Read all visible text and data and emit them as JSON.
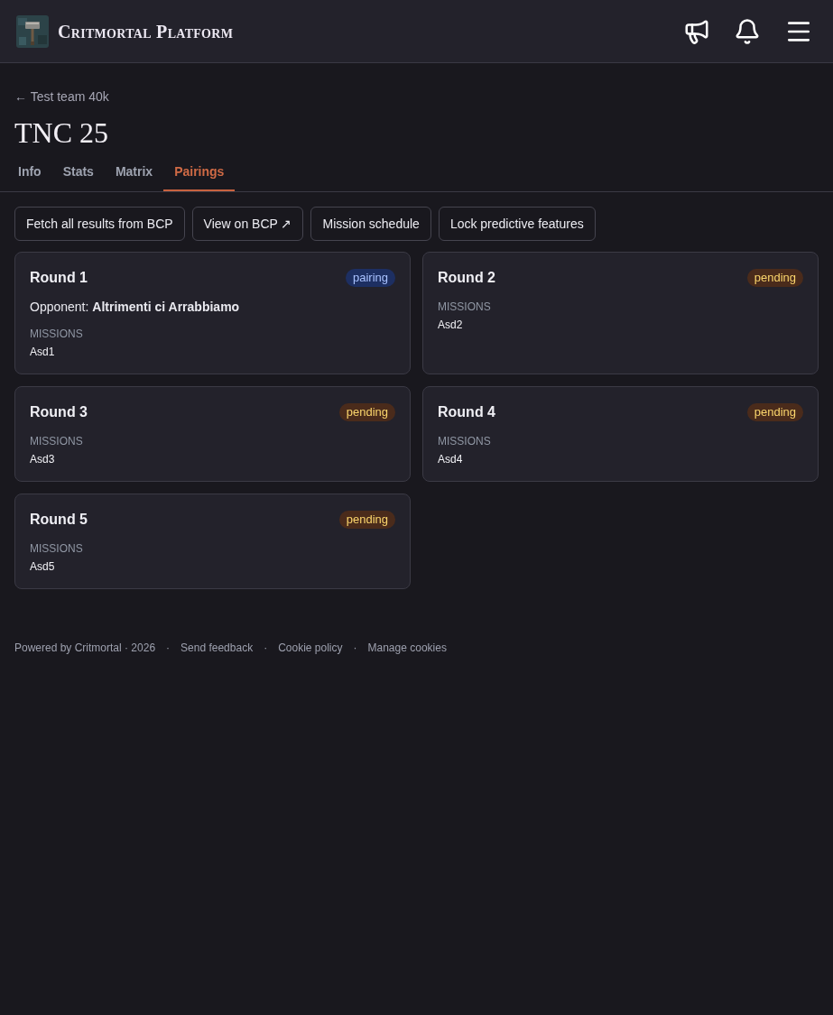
{
  "header": {
    "title": "Critmortal Platform"
  },
  "back_link": "← Test team 40k",
  "page_title": "TNC 25",
  "tabs": [
    {
      "label": "Info",
      "selected": false
    },
    {
      "label": "Stats",
      "selected": false
    },
    {
      "label": "Matrix",
      "selected": false
    },
    {
      "label": "Pairings",
      "selected": true
    }
  ],
  "actions": [
    "Fetch all results from BCP",
    "View on BCP ↗",
    "Mission schedule",
    "Lock predictive features"
  ],
  "rounds": [
    {
      "title": "Round 1",
      "status": {
        "label": "pairing",
        "kind": "pairing"
      },
      "opponent": "Opponent: **Altrimenti ci Arrabbiamo**",
      "missions_label": "MISSIONS",
      "missions": [
        "Asd1"
      ]
    },
    {
      "title": "Round 2",
      "status": {
        "label": "pending",
        "kind": "pending"
      },
      "missions_label": "MISSIONS",
      "missions": [
        "Asd2"
      ]
    },
    {
      "title": "Round 3",
      "status": {
        "label": "pending",
        "kind": "pending"
      },
      "missions_label": "MISSIONS",
      "missions": [
        "Asd3"
      ]
    },
    {
      "title": "Round 4",
      "status": {
        "label": "pending",
        "kind": "pending"
      },
      "missions_label": "MISSIONS",
      "missions": [
        "Asd4"
      ]
    },
    {
      "title": "Round 5",
      "status": {
        "label": "pending",
        "kind": "pending"
      },
      "missions_label": "MISSIONS",
      "missions": [
        "Asd5"
      ]
    }
  ],
  "footer": {
    "credit": "Powered by Critmortal · 2026",
    "links": [
      {
        "separator": "·",
        "label": "Send feedback"
      },
      {
        "separator": "·",
        "label": "Cookie policy"
      },
      {
        "separator": "·",
        "label": "Manage cookies"
      }
    ]
  }
}
